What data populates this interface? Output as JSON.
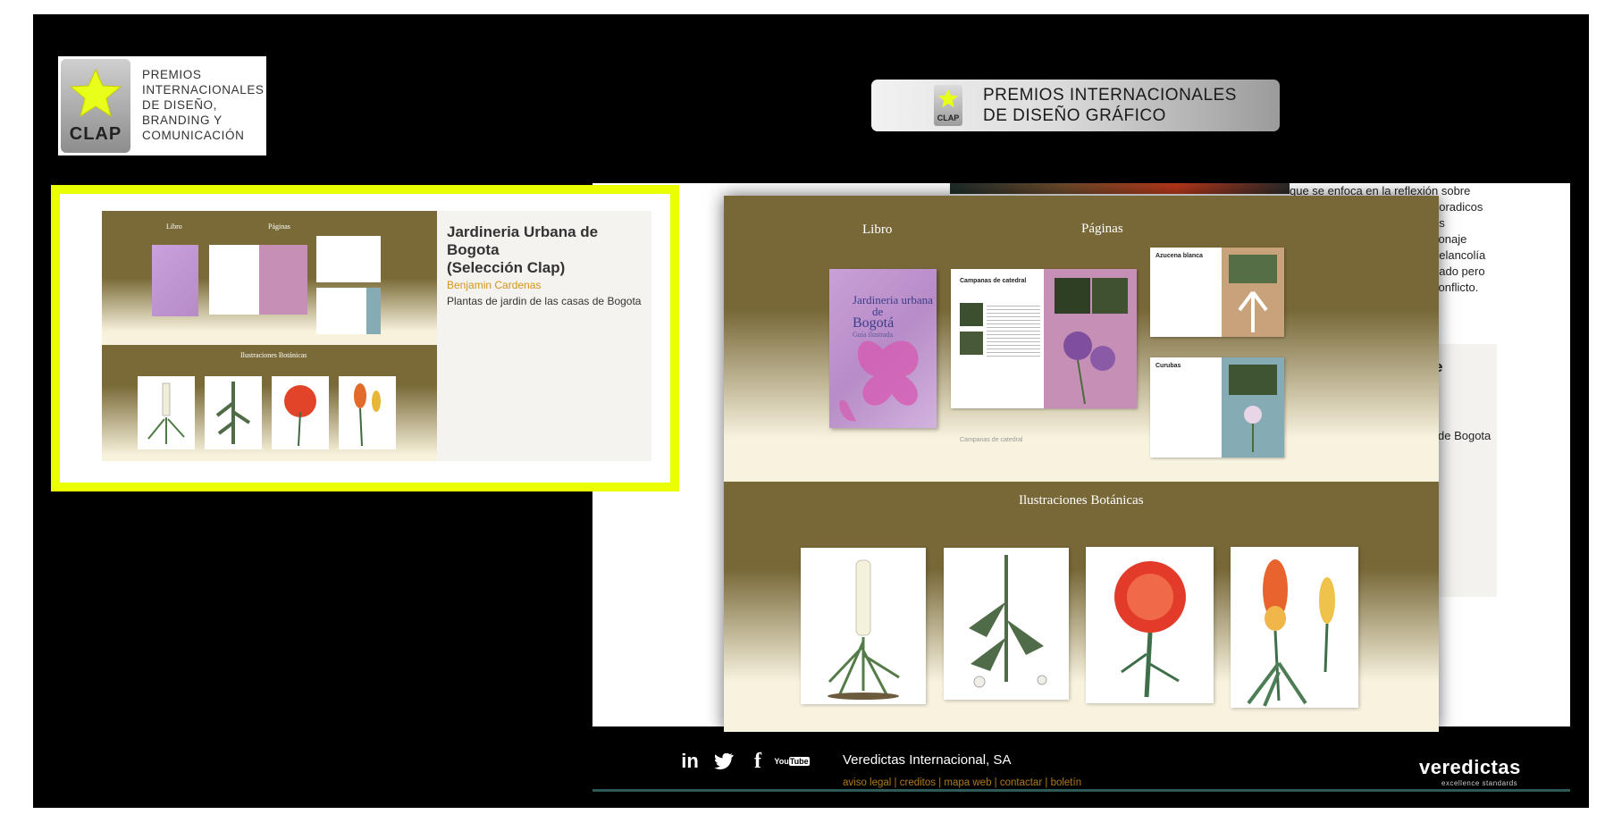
{
  "clap_badge": {
    "mark": "CLAP",
    "lines": [
      "PREMIOS",
      "INTERNACIONALES",
      "DE DISEÑO,",
      "BRANDING Y",
      "COMUNICACIÓN"
    ]
  },
  "banner": {
    "mark": "CLAP",
    "line1": "PREMIOS INTERNACIONALES",
    "line2": "DE DISEÑO GRÁFICO"
  },
  "highlight_card": {
    "title_line1": "Jardineria Urbana de",
    "title_line2": "Bogota",
    "title_line3": "(Selección Clap)",
    "author": "Benjamin Cardenas",
    "description": "Plantas de jardin de las casas de Bogota",
    "thumb_labels": {
      "libro": "Libro",
      "paginas": "Páginas",
      "ilustraciones": "Ilustraciones Botánicas"
    }
  },
  "preview": {
    "libro_label": "Libro",
    "paginas_label": "Páginas",
    "ilustraciones_label": "Ilustraciones Botánicas",
    "book_title_1": "Jardineria urbana",
    "book_title_2": "de",
    "book_title_3": "Bogotá",
    "book_subtitle": "Guía ilustrada",
    "page1_title": "Campanas de catedral",
    "page2_title": "Azucena blanca",
    "page3_title": "Curubas",
    "reflection_title": "Campanas de catedral"
  },
  "underlying_page": {
    "text_lines": [
      "que se enfoca en la reflexión sobre",
      "boradicos",
      "es",
      "sonaje",
      "nelancolía",
      "nado pero",
      "conflicto."
    ],
    "fragment_text": "de Bogota",
    "fragment_heading": "e"
  },
  "footer": {
    "social": [
      "linkedin-icon",
      "twitter-icon",
      "facebook-icon",
      "youtube-icon"
    ],
    "company": "Veredictas Internacional, SA",
    "links": [
      "aviso legal",
      "creditos",
      "mapa web",
      "contactar",
      "boletín"
    ],
    "logo": "veredictas",
    "logo_tagline": "excellence standards"
  },
  "colors": {
    "highlight_border": "#eaff00",
    "author_color": "#d2941c",
    "band_olive": "#786838",
    "footer_link": "#b07a1e"
  }
}
